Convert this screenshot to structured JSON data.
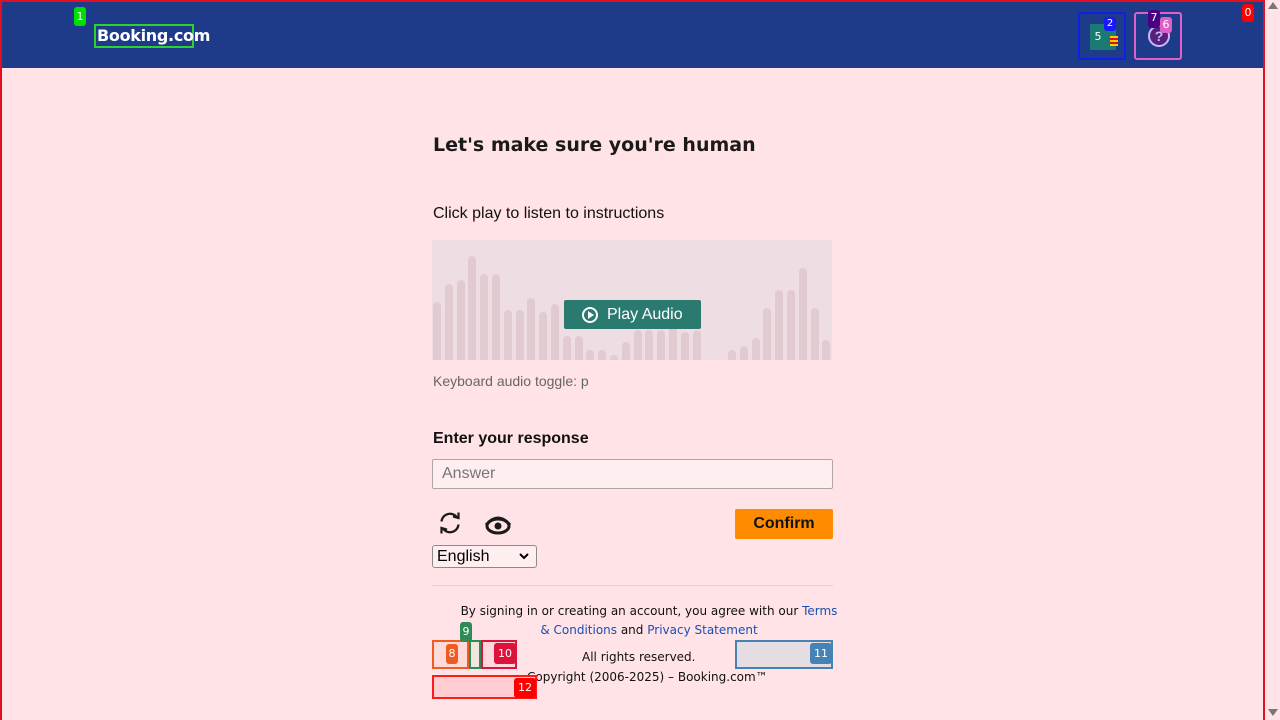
{
  "header": {
    "logo_text": "Booking.com",
    "currency_flag_icon": "currency-flag-icon",
    "help_icon": "question-icon"
  },
  "captcha": {
    "title": "Let's make sure you're human",
    "instructions": "Click play to listen to instructions",
    "play_button": "Play Audio",
    "keyboard_hint": "Keyboard audio toggle: p",
    "response_label": "Enter your response",
    "answer_placeholder": "Answer",
    "answer_value": "",
    "confirm_button": "Confirm",
    "reload_icon": "reload-icon",
    "vision_icon": "eye-icon",
    "language": {
      "selected": "English"
    }
  },
  "footer": {
    "legal_prefix": "By signing in or creating an account, you agree with our ",
    "terms_link": "Terms & Conditions",
    "and_text": " and ",
    "privacy_link": "Privacy Statement",
    "rights": "All rights reserved.",
    "copyright": "Copyright (2006-2025) – Booking.com™"
  },
  "overlay_labels": [
    "0",
    "1",
    "2",
    "5",
    "6",
    "7",
    "8",
    "9",
    "10",
    "11",
    "12"
  ],
  "colors": {
    "header": "#1d3b89",
    "background": "#ffe3e6",
    "play": "#2b7a70",
    "confirm": "#ff8c00",
    "link": "#1a4fb5"
  }
}
